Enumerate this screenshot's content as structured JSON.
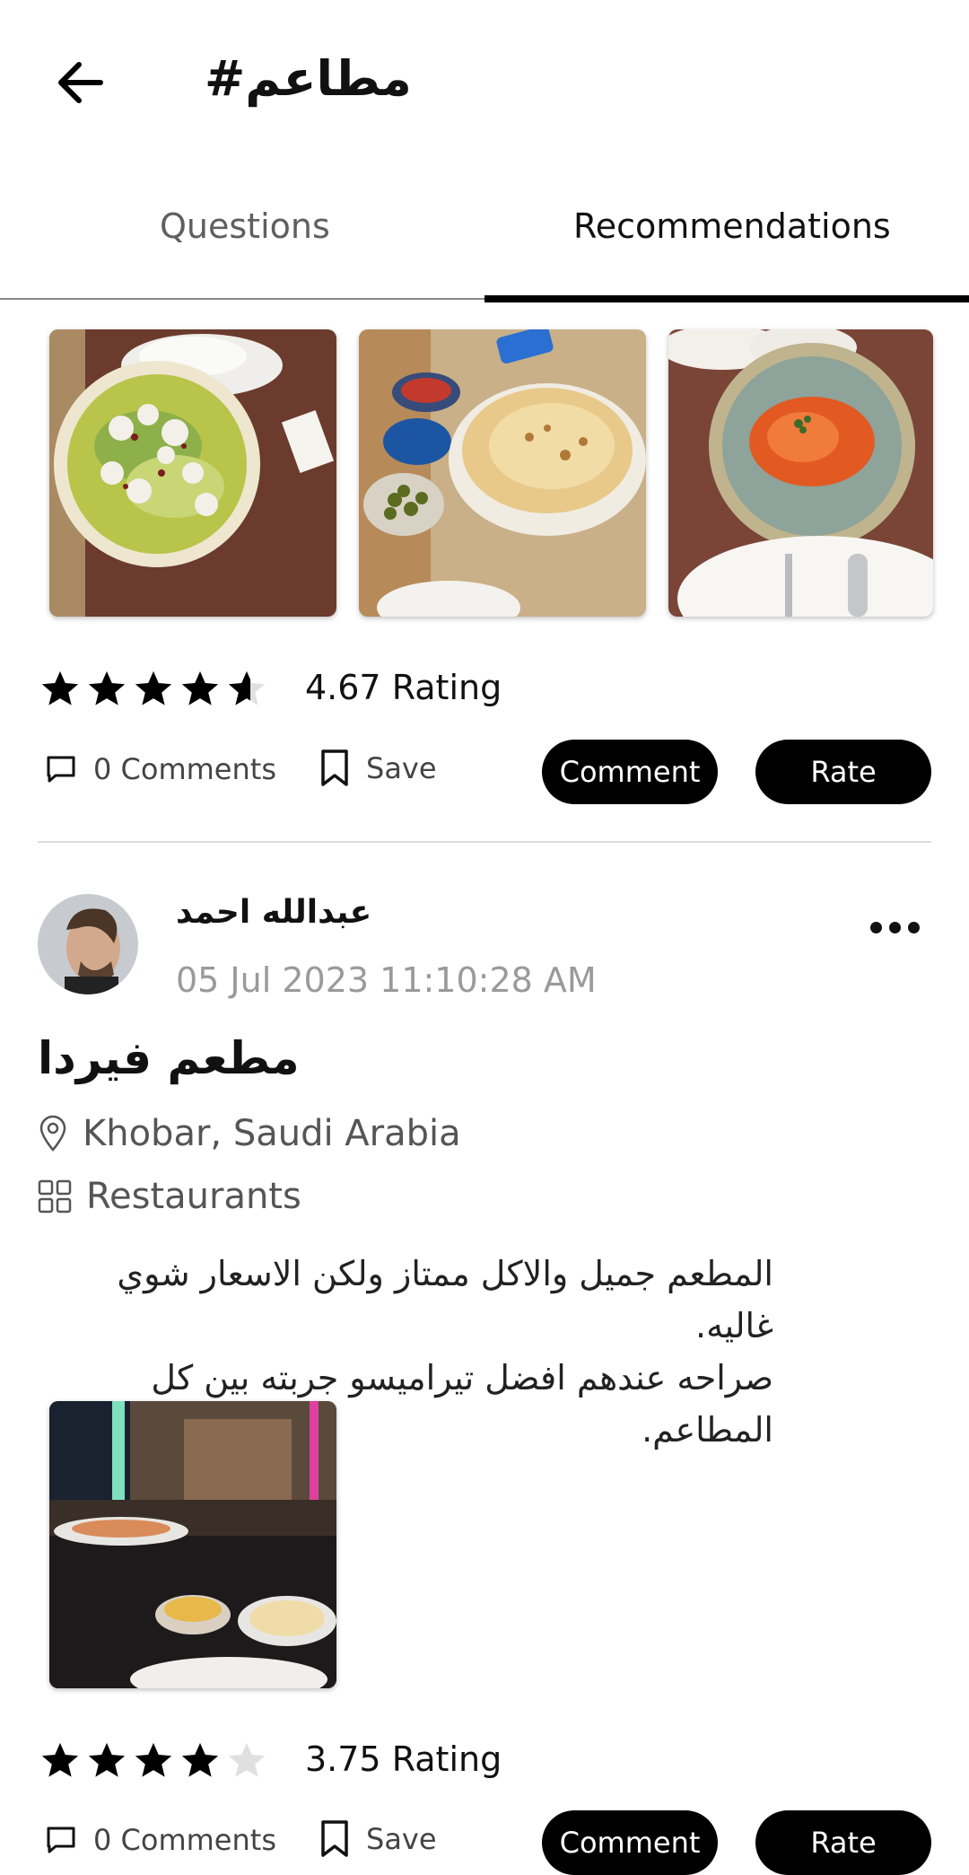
{
  "header": {
    "title": "#مطاعم"
  },
  "tabs": [
    {
      "label": "Questions",
      "active": false
    },
    {
      "label": "Recommendations",
      "active": true
    }
  ],
  "post1": {
    "rating": 4.67,
    "rating_text": "4.67 Rating",
    "comments_label": "0 Comments",
    "save_label": "Save",
    "comment_button": "Comment",
    "rate_button": "Rate"
  },
  "post2": {
    "author": "عبدالله احمد",
    "timestamp": "05 Jul 2023 11:10:28 AM",
    "title": "مطعم فيردا",
    "location": "Khobar,  Saudi Arabia",
    "category": "Restaurants",
    "body_line1": "المطعم جميل والاكل ممتاز ولكن الاسعار شوي غاليه.",
    "body_line2": "صراحه عندهم افضل تيراميسو جربته بين كل المطاعم.",
    "rating": 3.75,
    "rating_text": "3.75 Rating",
    "comments_label": "0 Comments",
    "save_label": "Save",
    "comment_button": "Comment",
    "rate_button": "Rate"
  },
  "colors": {
    "accent": "#000000",
    "muted": "#9a9a9a",
    "star_empty": "#e0e0e0"
  }
}
